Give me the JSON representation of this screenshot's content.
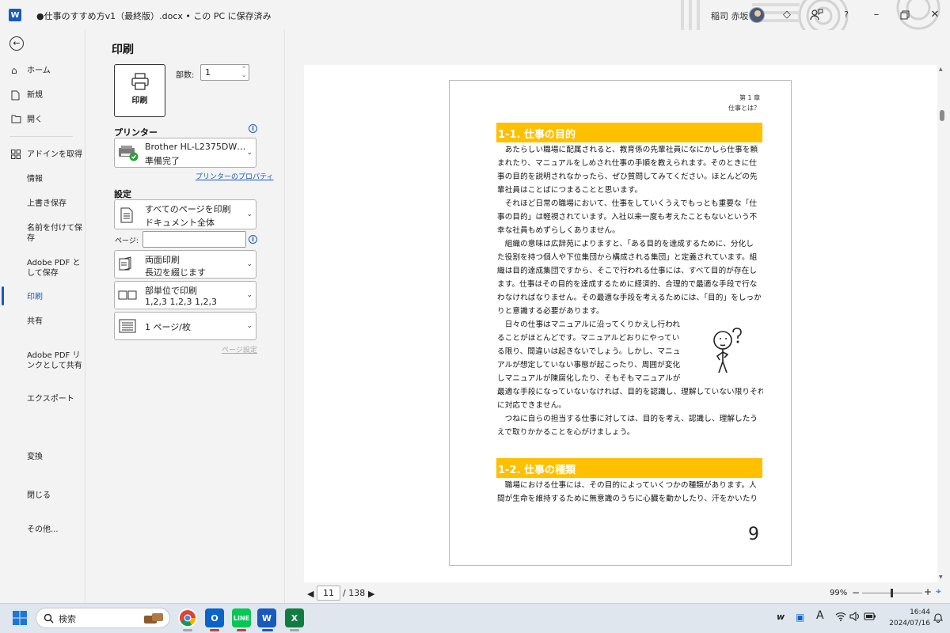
{
  "titlebar": {
    "app_logo": "W",
    "document_title": "●仕事のすすめ方v1（最終版）.docx • この PC に保存済み",
    "user_name": "稲司 赤坂",
    "icons": [
      "diamond-icon",
      "person-feedback-icon",
      "help-icon",
      "minimize-icon",
      "restore-icon",
      "close-icon"
    ]
  },
  "nav": {
    "back_icon": "back-arrow-icon",
    "items": [
      {
        "label": "ホーム",
        "icon": "home-icon"
      },
      {
        "label": "新規",
        "icon": "new-document-icon"
      },
      {
        "label": "開く",
        "icon": "folder-open-icon"
      },
      {
        "label": "アドインを取得",
        "icon": "addin-grid-icon"
      },
      {
        "label": "情報"
      },
      {
        "label": "上書き保存"
      },
      {
        "label": "名前を付けて保存"
      },
      {
        "label": "Adobe PDF として保存"
      },
      {
        "label": "印刷",
        "active": true
      },
      {
        "label": "共有"
      },
      {
        "label": "Adobe PDF リンクとして共有"
      },
      {
        "label": "エクスポート"
      },
      {
        "label": "変換"
      },
      {
        "label": "閉じる"
      },
      {
        "label": "その他..."
      }
    ]
  },
  "print": {
    "title": "印刷",
    "button_label": "印刷",
    "copies_label": "部数:",
    "copies_value": "1",
    "printer_section": "プリンター",
    "printer_name": "Brother HL-L2375DW…",
    "printer_status": "準備完了",
    "printer_properties": "プリンターのプロパティ",
    "settings_section": "設定",
    "pages_label": "ページ:",
    "pages_value": "",
    "page_setup": "ページ設定",
    "settings": [
      {
        "line1": "すべてのページを印刷",
        "line2": "ドキュメント全体",
        "icon": "pages-icon"
      },
      {
        "line1": "両面印刷",
        "line2": "長辺を綴じます",
        "icon": "duplex-icon"
      },
      {
        "line1": "部単位で印刷",
        "line2": "1,2,3    1,2,3    1,2,3",
        "icon": "collate-icon"
      },
      {
        "line1": "1 ページ/枚",
        "line2": "",
        "icon": "pages-per-sheet-icon"
      }
    ]
  },
  "preview": {
    "chapter": "第 1 章",
    "chapter_sub": "仕事とは？",
    "heading1": "1-1. 仕事の目的",
    "para1": [
      "　あたらしい職場に配属されると、教育係の先輩社員になにかしら仕事を頼",
      "まれたり、マニュアルをしめされ仕事の手順を教えられます。そのときに仕",
      "事の目的を説明されなかったら、ぜひ質問してみてください。ほとんどの先",
      "輩社員はことばにつまることと思います。"
    ],
    "para2": [
      "　それほど日常の職場において、仕事をしていくうえでもっとも重要な「仕",
      "事の目的」は軽視されています。入社以来一度も考えたこともないという不",
      "幸な社員もめずらしくありません。"
    ],
    "para3": [
      "　組織の意味は広辞苑によりますと、「ある目的を達成するために、分化し",
      "た役割を持つ個人や下位集団から構成される集団」と定義されています。組",
      "織は目的達成集団ですから、そこで行われる仕事には、すべて目的が存在し",
      "ます。仕事はその目的を達成するために経済的、合理的で最適な手段で行な",
      "わなければなりません。その最適な手段を考えるためには、「目的」をしっか",
      "りと意識する必要があります。"
    ],
    "para4_narrow": [
      "　日々の仕事はマニュアルに沿ってくりかえし行われ",
      "ることがほとんどです。マニュアルどおりにやってい",
      "る限り、間違いは起きないでしょう。しかし、マニュ",
      "アルが想定していない事態が起こったり、周囲が変化",
      "しマニュアルが陳腐化したり、そもそもマニュアルが"
    ],
    "para4_wide": [
      "最適な手段になっていないなければ、目的を認識し、理解していない限りそれら",
      "に対応できません。"
    ],
    "para5": [
      "　つねに自らの担当する仕事に対しては、目的を考え、認識し、理解したう",
      "えで取りかかることを心がけましょう。"
    ],
    "heading2": "1-2. 仕事の種類",
    "para6": [
      "　職場における仕事には、その目的によっていくつかの種類があります。人",
      "間が生命を維持するために無意識のうちに心臓を動かしたり、汗をかいたり"
    ],
    "page_number": "9"
  },
  "pager": {
    "current": "11",
    "total": "/ 138",
    "zoom": "99%"
  },
  "taskbar": {
    "search_placeholder": "検索",
    "apps": [
      "chrome-icon",
      "outlook-icon",
      "line-icon",
      "word-icon",
      "excel-icon"
    ],
    "time": "16:44",
    "date": "2024/07/16",
    "tray_ime": "A"
  }
}
